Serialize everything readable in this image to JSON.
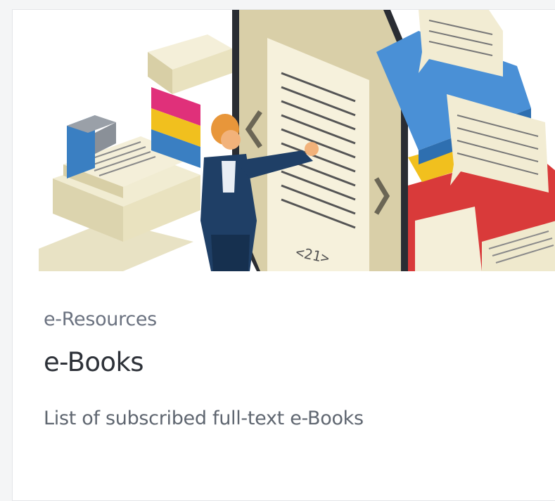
{
  "card": {
    "category": "e-Resources",
    "title": "e-Books",
    "description": "List of subscribed full-text e-Books",
    "illustration": {
      "icon": "ebook-reader-illustration",
      "page_number": "<21>"
    }
  },
  "colors": {
    "card_background": "#ffffff",
    "page_background": "#f4f5f6",
    "title_text": "#2d3138",
    "muted_text": "#6b7280"
  }
}
